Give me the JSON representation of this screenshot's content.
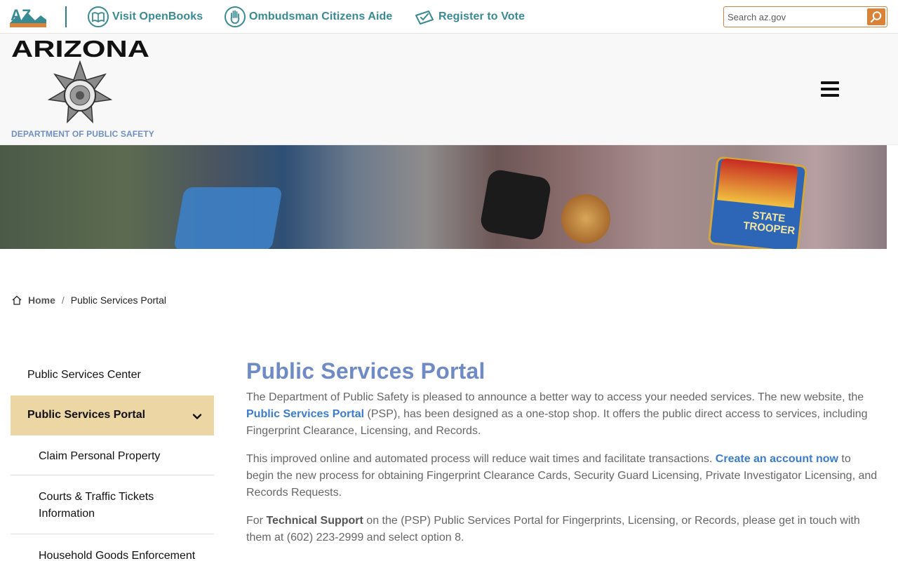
{
  "topbar": {
    "az_logo_text": "AZ",
    "links": [
      {
        "label": "Visit OpenBooks",
        "icon": "open-book-icon"
      },
      {
        "label": "Ombudsman Citizens Aide",
        "icon": "hand-icon"
      },
      {
        "label": "Register to Vote",
        "icon": "ballot-icon"
      }
    ],
    "search": {
      "placeholder": "Search az.gov",
      "value": ""
    },
    "colors": {
      "link": "#3a8a93",
      "search_accent": "#d9823a"
    }
  },
  "header": {
    "state_wordmark": "ARIZONA",
    "department": "DEPARTMENT OF PUBLIC SAFETY",
    "badge_icon": "dps-star-badge-icon",
    "menu_icon": "hamburger-menu-icon"
  },
  "hero": {
    "patch_text": "STATE TROOPER"
  },
  "breadcrumb": {
    "home": "Home",
    "separator": "/",
    "current": "Public Services Portal"
  },
  "sidebar": {
    "top_item": "Public Services Center",
    "active_item": "Public Services Portal",
    "sub_items": [
      "Claim Personal Property",
      "Courts & Traffic Tickets Information",
      "Household Goods Enforcement"
    ],
    "active_color": "#ecd6a3"
  },
  "main": {
    "title": "Public Services Portal",
    "p1": {
      "before": "The Department of Public Safety is pleased to announce a better way to access your needed services. The new website, the ",
      "link": "Public Services Portal",
      "after": " (PSP), has been designed as a one-stop shop. It offers the public direct access to services, including Fingerprint Clearance, Licensing, and Records."
    },
    "p2": {
      "before": "This improved online and automated process will reduce wait times and facilitate transactions. ",
      "link": "Create an account now",
      "after": " to begin the new process for obtaining Fingerprint Clearance Cards, Security Guard Licensing, Private Investigator Licensing, and Records Requests."
    },
    "p3": {
      "before": "For ",
      "bold": "Technical Support",
      "after": " on the (PSP) Public Services Portal for Fingerprints, Licensing, or Records, please get in touch with them at (602) 223-2999 and select option 8."
    },
    "title_color": "#6f8bc6",
    "link_color": "#3a7dd0"
  }
}
